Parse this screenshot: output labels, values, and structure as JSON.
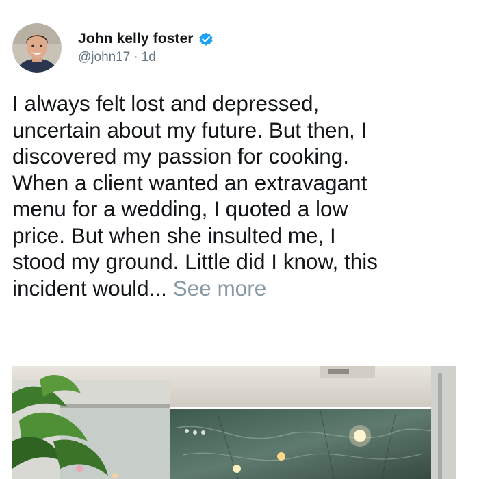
{
  "author": {
    "name": "John kelly foster",
    "handle": "@john17",
    "separator": "·",
    "time": "1d",
    "verified_icon": "verified-badge-icon",
    "avatar": "profile-photo"
  },
  "tweet": {
    "text_lines": "I always felt lost and depressed,\nuncertain about my future. But then, I\ndiscovered my passion for cooking.\nWhen a client wanted an extravagant\nmenu for a wedding, I quoted a low\nprice. But when she insulted me, I\nstood my ground. Little did I know, this\nincident would...",
    "see_more": " See more"
  },
  "colors": {
    "name": "#14171a",
    "meta": "#657786",
    "see_more": "#8899a6",
    "verified": "#1da1f2"
  }
}
